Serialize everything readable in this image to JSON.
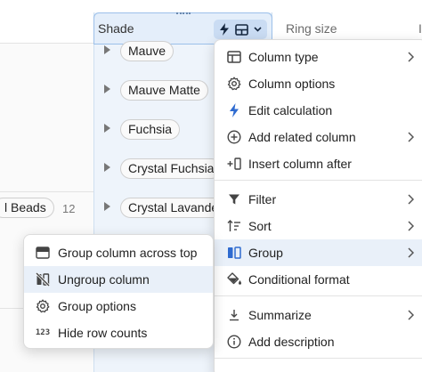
{
  "columns": {
    "shade": "Shade",
    "ring_size": "Ring size",
    "partial_next": "I"
  },
  "rows": [
    "Mauve",
    "Mauve Matte",
    "Fuchsia",
    "Crystal Fuchsia",
    "Crystal Lavande"
  ],
  "group_row": {
    "label": "l Beads",
    "count": "12"
  },
  "column_menu": {
    "column_type": "Column type",
    "column_options": "Column options",
    "edit_calculation": "Edit calculation",
    "add_related_column": "Add related column",
    "insert_column_after": "Insert column after",
    "filter": "Filter",
    "sort": "Sort",
    "group": "Group",
    "conditional_format": "Conditional format",
    "summarize": "Summarize",
    "add_description": "Add description"
  },
  "group_submenu": {
    "group_column_across_top": "Group column across top",
    "ungroup_column": "Ungroup column",
    "group_options": "Group options",
    "hide_row_counts": "Hide row counts",
    "row_count_glyph": "123"
  },
  "colors": {
    "accent": "#2f6bd0",
    "selected_column_bg": "#eef4fb",
    "active_item_bg": "#e9f0f9"
  }
}
